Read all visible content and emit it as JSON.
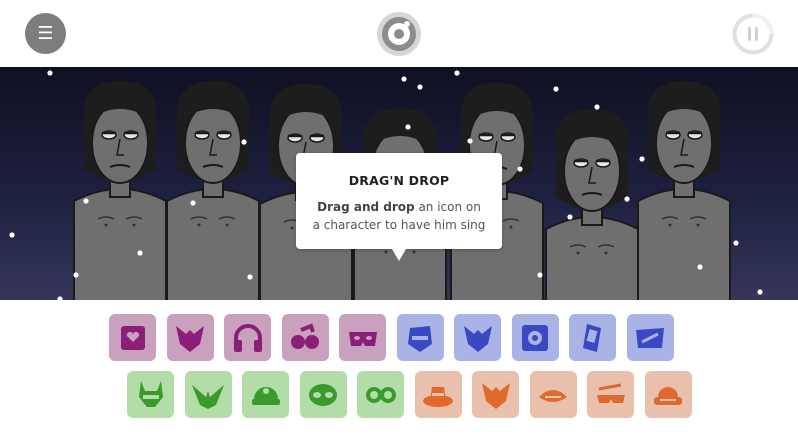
{
  "header": {
    "menu_icon": "hamburger-icon",
    "logo_icon": "incredibox-logo-icon",
    "pause_icon": "pause-icon"
  },
  "stage": {
    "characters": 7,
    "background_top": "#0f1022",
    "background_bottom": "#35365a",
    "character_color": "#6f6f6f"
  },
  "tooltip": {
    "title": "DRAG'N DROP",
    "body_strong": "Drag and drop",
    "body_line1_rest": " an icon on",
    "body_line2": "a character to have him sing"
  },
  "palette": {
    "beats_bg": "#c9a0be",
    "beats_fg": "#8a1f78",
    "effects_bg": "#a9b3e6",
    "effects_fg": "#3a48c4",
    "melodies_bg": "#b2dca8",
    "melodies_fg": "#3a9a2a",
    "voices_bg": "#e8c0ac",
    "voices_fg": "#e06a2e"
  },
  "icons_row1": [
    {
      "name": "beat-tv-icon",
      "group": "beats"
    },
    {
      "name": "beat-fox-icon",
      "group": "beats"
    },
    {
      "name": "beat-headphones-icon",
      "group": "beats"
    },
    {
      "name": "beat-glasses-icon",
      "group": "beats"
    },
    {
      "name": "beat-mask-icon",
      "group": "beats"
    },
    {
      "name": "effect-helmet-icon",
      "group": "effects"
    },
    {
      "name": "effect-fox-icon",
      "group": "effects"
    },
    {
      "name": "effect-speaker-icon",
      "group": "effects"
    },
    {
      "name": "effect-phone-icon",
      "group": "effects"
    },
    {
      "name": "effect-visor-icon",
      "group": "effects"
    }
  ],
  "icons_row2": [
    {
      "name": "melody-horns-icon",
      "group": "melodies"
    },
    {
      "name": "melody-wings-icon",
      "group": "melodies"
    },
    {
      "name": "melody-cap-icon",
      "group": "melodies"
    },
    {
      "name": "melody-alien-icon",
      "group": "melodies"
    },
    {
      "name": "melody-goggles-icon",
      "group": "melodies"
    },
    {
      "name": "voice-hat-icon",
      "group": "voices"
    },
    {
      "name": "voice-fox-icon",
      "group": "voices"
    },
    {
      "name": "voice-mouth-icon",
      "group": "voices"
    },
    {
      "name": "voice-shades-icon",
      "group": "voices"
    },
    {
      "name": "voice-cap-icon",
      "group": "voices"
    }
  ]
}
